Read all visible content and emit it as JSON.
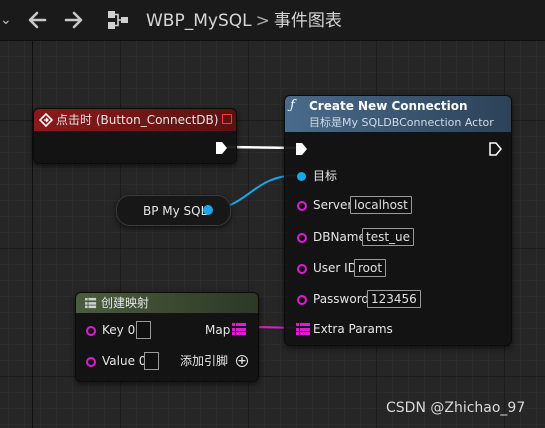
{
  "header": {
    "back_icon": "back-arrow-icon",
    "forward_icon": "forward-arrow-icon",
    "blueprint_icon": "blueprint-graph-icon",
    "breadcrumb": [
      "WBP_MySQL",
      "事件图表"
    ],
    "separator": ">"
  },
  "nodes": {
    "event": {
      "title": "点击时 (Button_ConnectDB)",
      "header_color": "#8b1a1a"
    },
    "variable": {
      "label": "BP My SQL"
    },
    "create_connection": {
      "title": "Create New Connection",
      "subtitle": "目标是My SQLDBConnection Actor",
      "header_color": "#3e5a77",
      "pins": {
        "target": "目标",
        "server": "Server",
        "server_value": "localhost",
        "dbname": "DBName",
        "dbname_value": "test_ue",
        "userid": "User ID",
        "userid_value": "root",
        "password": "Password",
        "password_value": "123456",
        "extra_params": "Extra Params"
      }
    },
    "make_map": {
      "title": "创建映射",
      "header_color": "#3d4d33",
      "key_label": "Key 0",
      "value_label": "Value 0",
      "map_label": "Map",
      "add_pin_label": "添加引脚"
    }
  },
  "colors": {
    "object_pin": "#1aa7ec",
    "string_pin": "#e01bd5",
    "exec_wire": "#ffffff"
  },
  "watermark": "CSDN @Zhichao_97"
}
